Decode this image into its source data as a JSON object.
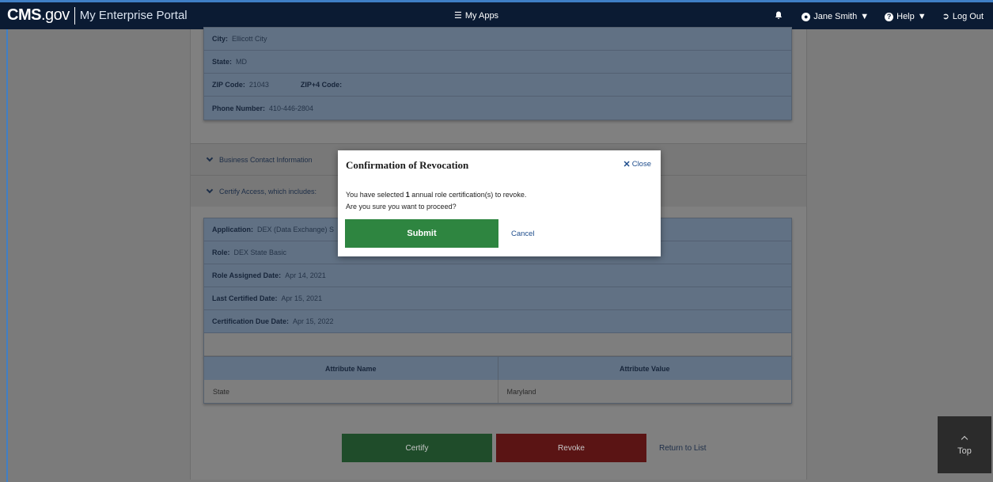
{
  "navbar": {
    "brand_logo_main": "CMS",
    "brand_logo_suffix": ".gov",
    "portal_name": "My Enterprise Portal",
    "apps_label": "My Apps",
    "user_name": "Jane Smith",
    "help_label": "Help",
    "logout_label": "Log Out"
  },
  "address": {
    "city_label": "City:",
    "city_value": "Ellicott City",
    "state_label": "State:",
    "state_value": "MD",
    "zip_label": "ZIP Code:",
    "zip_value": "21043",
    "zip4_label": "ZIP+4 Code:",
    "phone_label": "Phone Number:",
    "phone_value": "410-446-2804"
  },
  "sections": {
    "business_contact": "Business Contact Information",
    "certify_access": "Certify Access, which includes:"
  },
  "access": {
    "application_label": "Application:",
    "application_value": "DEX (Data Exchange) S",
    "role_label": "Role:",
    "role_value": "DEX State Basic",
    "assigned_label": "Role Assigned Date:",
    "assigned_value": "Apr 14, 2021",
    "last_certified_label": "Last Certified Date:",
    "last_certified_value": "Apr 15, 2021",
    "due_label": "Certification Due Date:",
    "due_value": "Apr 15, 2022"
  },
  "attributes": {
    "col_name": "Attribute Name",
    "col_value": "Attribute Value",
    "rows": [
      {
        "name": "State",
        "value": "Maryland"
      }
    ]
  },
  "actions": {
    "certify": "Certify",
    "revoke": "Revoke",
    "return": "Return to List",
    "top": "Top"
  },
  "modal": {
    "title": "Confirmation of Revocation",
    "close": "Close",
    "body_prefix": "You have selected ",
    "body_count": "1",
    "body_suffix": " annual role certification(s) to revoke.",
    "body_line2": "Are you sure you want to proceed?",
    "submit": "Submit",
    "cancel": "Cancel"
  }
}
